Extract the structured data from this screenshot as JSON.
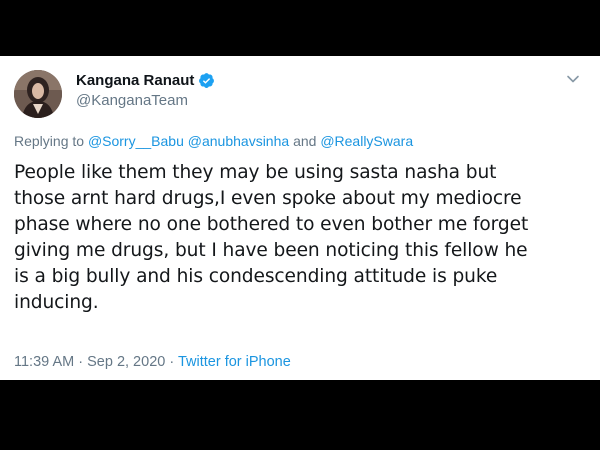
{
  "tweet": {
    "display_name": "Kangana Ranaut",
    "handle": "@KanganaTeam",
    "verified": true,
    "avatar_icon": "profile-photo",
    "menu_icon": "chevron-down-icon",
    "reply": {
      "prefix": "Replying to",
      "mentions": [
        "@Sorry__Babu",
        "@anubhavsinha",
        "@ReallySwara"
      ],
      "conjunction": "and"
    },
    "text_lines": [
      "People like them they may be using sasta nasha but",
      "those arnt hard drugs,I even spoke about my mediocre",
      "phase where no one bothered to even bother me forget",
      "giving me drugs, but I have been noticing this fellow he",
      "is a big bully and his condescending attitude is puke",
      "inducing."
    ],
    "time": "11:39 AM",
    "date": "Sep 2, 2020",
    "separator": "·",
    "source": "Twitter for iPhone"
  },
  "colors": {
    "background": "#000000",
    "card": "#ffffff",
    "link": "#1b95e0",
    "muted": "#657786",
    "verified_badge": "#1da1f2"
  }
}
